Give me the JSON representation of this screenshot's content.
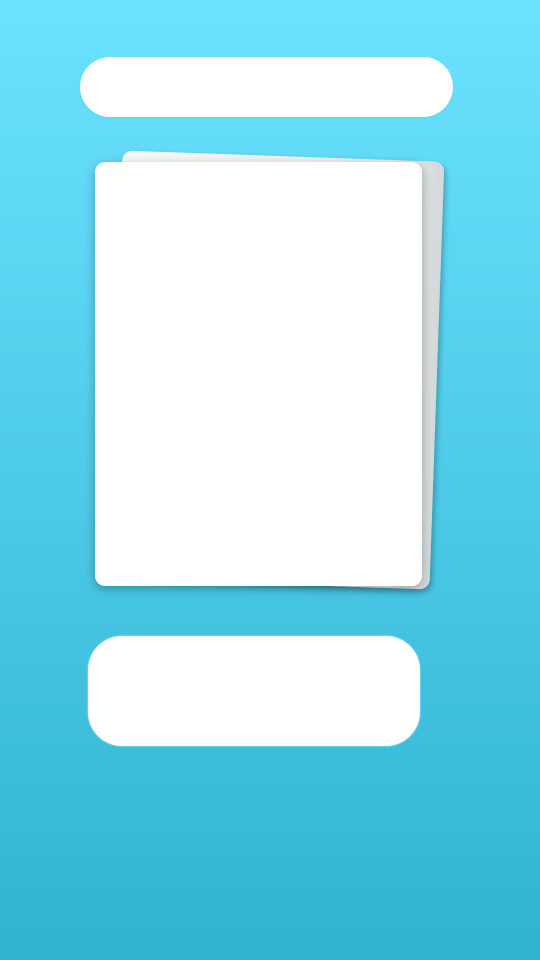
{
  "screen": {
    "background": {
      "top_color": "#6be2ff",
      "bottom_color": "#2fb3d1"
    },
    "title_bar": {
      "label": ""
    },
    "card": {
      "content": ""
    },
    "action_button": {
      "label": ""
    }
  }
}
